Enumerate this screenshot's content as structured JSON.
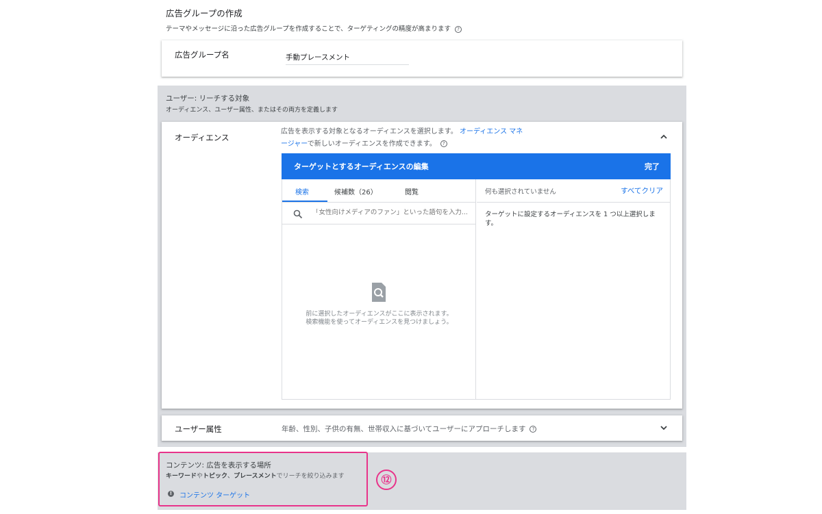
{
  "header": {
    "title": "広告グループの作成",
    "subtitle": "テーマやメッセージに沿った広告グループを作成することで、ターゲティングの精度が高まります",
    "help_icon": "question-circle-icon"
  },
  "ad_group_name": {
    "label": "広告グループ名",
    "value": "手動プレースメント"
  },
  "user_section": {
    "title": "ユーザー: リーチする対象",
    "subtitle": "オーディエンス、ユーザー属性、またはその両方を定義します"
  },
  "audience": {
    "label": "オーディエンス",
    "desc_prefix": "広告を表示する対象となるオーディエンスを選択します。",
    "desc_link": "オーディエンス マネージャー",
    "desc_suffix": "で新しいオーディエンスを作成できます。",
    "expanded": true
  },
  "editor": {
    "title": "ターゲットとするオーディエンスの編集",
    "done_label": "完了",
    "tabs": [
      {
        "label": "検索",
        "active": true
      },
      {
        "label": "候補数（26）",
        "active": false
      },
      {
        "label": "閲覧",
        "active": false
      }
    ],
    "search_placeholder": "「女性向けメディアのファン」といった語句を入力...",
    "empty_line1": "前に選択したオーディエンスがここに表示されます。",
    "empty_line2": "検索機能を使ってオーディエンスを見つけましょう。",
    "selected_none": "何も選択されていません",
    "clear_all": "すべてクリア",
    "right_message": "ターゲットに設定するオーディエンスを 1 つ以上選択します。"
  },
  "demographics": {
    "label": "ユーザー属性",
    "desc": "年齢、性別、子供の有無、世帯収入に基づいてユーザーにアプローチします",
    "expanded": false
  },
  "content_section": {
    "title": "コンテンツ: 広告を表示する場所",
    "subtitle_part1": "キーワード",
    "subtitle_part2": "や",
    "subtitle_part3": "トピック",
    "subtitle_part4": "、",
    "subtitle_part5": "プレースメント",
    "subtitle_part6": "でリーチを絞り込みます",
    "link": "コンテンツ ターゲット"
  },
  "annotation": {
    "badge": "⑫",
    "color": "#e8338a"
  },
  "colors": {
    "primary": "#1a73e8",
    "panel_grey": "#dadce0"
  }
}
